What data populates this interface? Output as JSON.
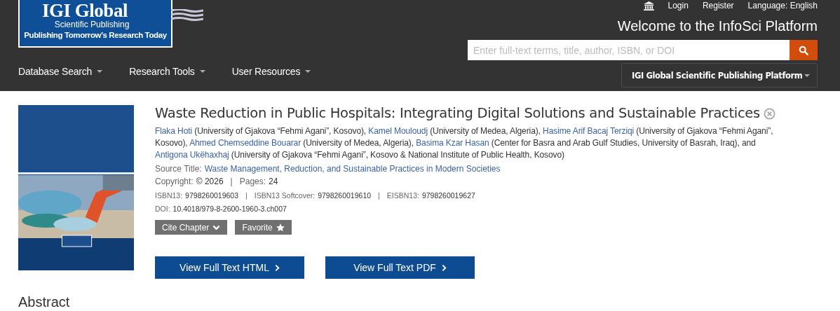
{
  "header": {
    "logo": {
      "name": "IGI Global",
      "subtitle": "Scientific Publishing",
      "tagline": "Publishing Tomorrow’s Research Today"
    },
    "top_links": [
      "Login",
      "Register",
      "Language: English"
    ],
    "welcome": "Welcome to the InfoSci Platform",
    "search": {
      "placeholder": "Enter full-text terms, title, author, ISBN, or DOI"
    },
    "nav": [
      "Database Search",
      "Research Tools",
      "User Resources"
    ],
    "platform": "IGI Global Scientific Publishing Platform"
  },
  "chapter": {
    "title": "Waste Reduction in Public Hospitals: Integrating Digital Solutions and Sustainable Practices",
    "authors": [
      {
        "name": "Flaka Hoti",
        "affiliation": " (University of Gjakova “Fehmi Agani”, Kosovo), "
      },
      {
        "name": "Kamel Mouloudj",
        "affiliation": " (University of Medea, Algeria), "
      },
      {
        "name": "Hasime Arif Bacaj Terziqi",
        "affiliation": " (University of Gjakova “Fehmi Agani”, Kosovo), "
      },
      {
        "name": "Ahmed Chemseddine Bouarar",
        "affiliation": " (University of Medea, Algeria), "
      },
      {
        "name": "Basima Kzar Hasan",
        "affiliation": " (Center for Basra and Arab Gulf Studies, University of Basrah, Iraq), and "
      },
      {
        "name": "Antigona Ukëhaxhaj",
        "affiliation": " (University of Gjakova “Fehmi Agani”, Kosovo & National Institute of Public Health, Kosovo)"
      }
    ],
    "source": {
      "label": "Source Title:",
      "value": "Waste Management, Reduction, and Sustainable Practices in Modern Societies"
    },
    "meta_rows": [
      {
        "kind": "large",
        "separator": "|",
        "items": [
          {
            "label": "Copyright:",
            "value": "© 2026"
          },
          {
            "label": "Pages:",
            "value": "24"
          }
        ]
      },
      {
        "kind": "small",
        "separator": "|",
        "items": [
          {
            "label": "ISBN13:",
            "value": "9798260019603"
          },
          {
            "label": "ISBN13 Softcover:",
            "value": "9798260019610"
          },
          {
            "label": "EISBN13:",
            "value": "9798260019627"
          }
        ]
      },
      {
        "kind": "small",
        "items": [
          {
            "label": "DOI:",
            "value": "10.4018/979-8-2600-1960-3.ch007"
          }
        ]
      }
    ],
    "actions": [
      "Cite Chapter",
      "Favorite"
    ],
    "full_text": [
      "View Full Text HTML",
      "View Full Text PDF"
    ]
  },
  "abstract_heading": "Abstract"
}
